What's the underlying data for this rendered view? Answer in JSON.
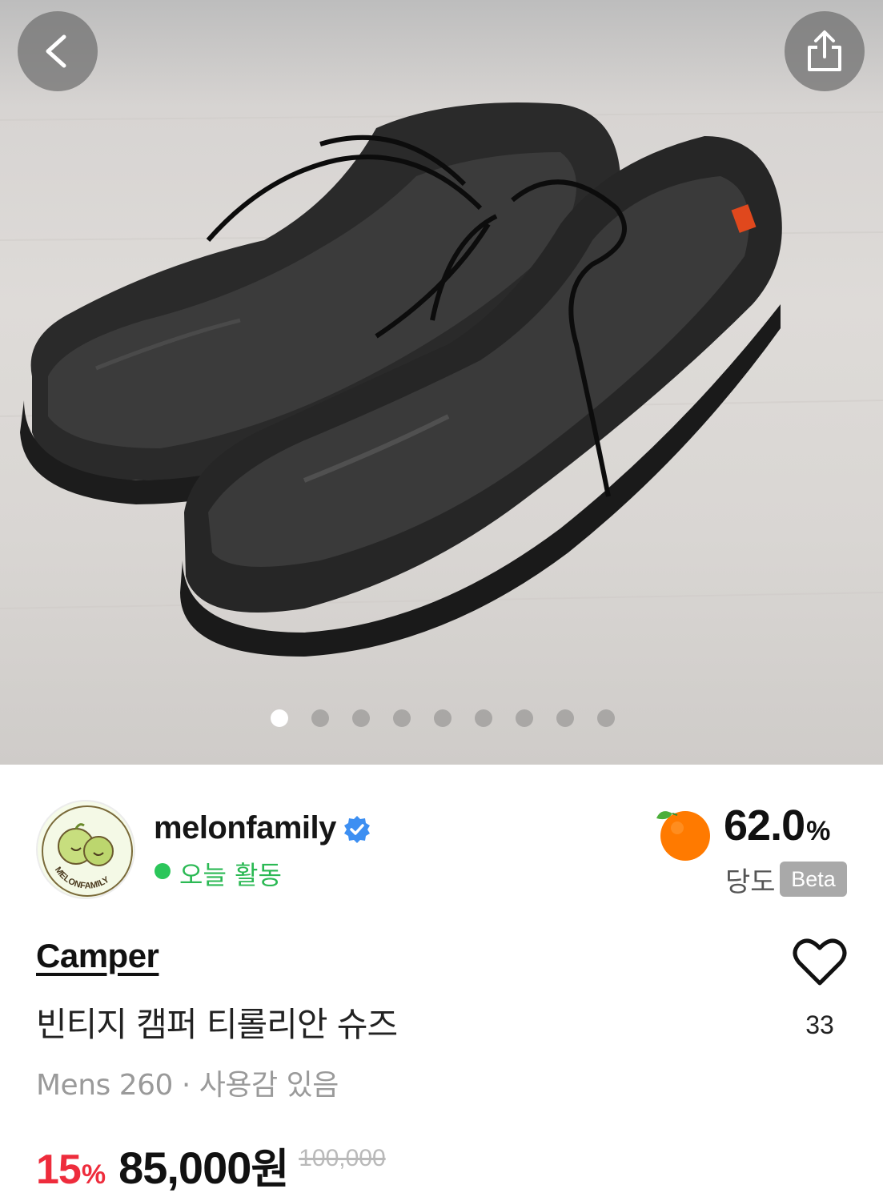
{
  "gallery": {
    "image_count": 9,
    "active_index": 0
  },
  "seller": {
    "name": "melonfamily",
    "status": "오늘 활동",
    "logo_text": "MELONFAMILY"
  },
  "sweetness": {
    "value": "62.0",
    "unit": "%",
    "label": "당도",
    "badge": "Beta",
    "accent": "#ff7a00"
  },
  "product": {
    "brand": "Camper",
    "title": "빈티지 캠퍼 티롤리안 슈즈",
    "meta": "Mens 260 · 사용감 있음",
    "likes": "33",
    "discount": "15",
    "discount_unit": "%",
    "price": "85,000",
    "currency": "원",
    "original_price": "100,000"
  },
  "colors": {
    "discount": "#ee2c3c",
    "online": "#2bc65a",
    "verified": "#3d8ff2"
  }
}
